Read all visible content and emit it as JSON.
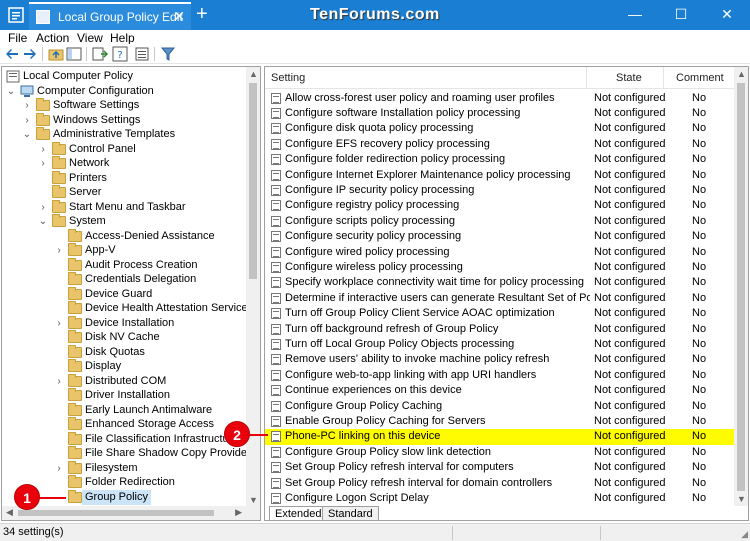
{
  "titlebar": {
    "tab_title": "Local Group Policy Edit",
    "tab_close": "✕",
    "new_tab": "+",
    "watermark": "TenForums.com",
    "minimize": "—",
    "maximize": "☐",
    "close": "✕"
  },
  "menu": {
    "items": [
      "File",
      "Action",
      "View",
      "Help"
    ]
  },
  "tree": {
    "items": [
      {
        "label": "Local Computer Policy"
      },
      {
        "label": "Computer Configuration"
      },
      {
        "label": "Software Settings"
      },
      {
        "label": "Windows Settings"
      },
      {
        "label": "Administrative Templates"
      },
      {
        "label": "Control Panel"
      },
      {
        "label": "Network"
      },
      {
        "label": "Printers"
      },
      {
        "label": "Server"
      },
      {
        "label": "Start Menu and Taskbar"
      },
      {
        "label": "System"
      },
      {
        "label": "Access-Denied Assistance"
      },
      {
        "label": "App-V"
      },
      {
        "label": "Audit Process Creation"
      },
      {
        "label": "Credentials Delegation"
      },
      {
        "label": "Device Guard"
      },
      {
        "label": "Device Health Attestation Service"
      },
      {
        "label": "Device Installation"
      },
      {
        "label": "Disk NV Cache"
      },
      {
        "label": "Disk Quotas"
      },
      {
        "label": "Display"
      },
      {
        "label": "Distributed COM"
      },
      {
        "label": "Driver Installation"
      },
      {
        "label": "Early Launch Antimalware"
      },
      {
        "label": "Enhanced Storage Access"
      },
      {
        "label": "File Classification Infrastructure"
      },
      {
        "label": "File Share Shadow Copy Provider"
      },
      {
        "label": "Filesystem"
      },
      {
        "label": "Folder Redirection"
      },
      {
        "label": "Group Policy"
      }
    ]
  },
  "list": {
    "headers": {
      "setting": "Setting",
      "state": "State",
      "comment": "Comment"
    },
    "rows": [
      {
        "name": "Allow cross-forest user policy and roaming user profiles",
        "state": "Not configured",
        "comment": "No"
      },
      {
        "name": "Configure software Installation policy processing",
        "state": "Not configured",
        "comment": "No"
      },
      {
        "name": "Configure disk quota policy processing",
        "state": "Not configured",
        "comment": "No"
      },
      {
        "name": "Configure EFS recovery policy processing",
        "state": "Not configured",
        "comment": "No"
      },
      {
        "name": "Configure folder redirection policy processing",
        "state": "Not configured",
        "comment": "No"
      },
      {
        "name": "Configure Internet Explorer Maintenance policy processing",
        "state": "Not configured",
        "comment": "No"
      },
      {
        "name": "Configure IP security policy processing",
        "state": "Not configured",
        "comment": "No"
      },
      {
        "name": "Configure registry policy processing",
        "state": "Not configured",
        "comment": "No"
      },
      {
        "name": "Configure scripts policy processing",
        "state": "Not configured",
        "comment": "No"
      },
      {
        "name": "Configure security policy processing",
        "state": "Not configured",
        "comment": "No"
      },
      {
        "name": "Configure wired policy processing",
        "state": "Not configured",
        "comment": "No"
      },
      {
        "name": "Configure wireless policy processing",
        "state": "Not configured",
        "comment": "No"
      },
      {
        "name": "Specify workplace connectivity wait time for policy processing",
        "state": "Not configured",
        "comment": "No"
      },
      {
        "name": "Determine if interactive users can generate Resultant Set of Policy data",
        "state": "Not configured",
        "comment": "No"
      },
      {
        "name": "Turn off Group Policy Client Service AOAC optimization",
        "state": "Not configured",
        "comment": "No"
      },
      {
        "name": "Turn off background refresh of Group Policy",
        "state": "Not configured",
        "comment": "No"
      },
      {
        "name": "Turn off Local Group Policy Objects processing",
        "state": "Not configured",
        "comment": "No"
      },
      {
        "name": "Remove users' ability to invoke machine policy refresh",
        "state": "Not configured",
        "comment": "No"
      },
      {
        "name": "Configure web-to-app linking with app URI handlers",
        "state": "Not configured",
        "comment": "No"
      },
      {
        "name": "Continue experiences on this device",
        "state": "Not configured",
        "comment": "No"
      },
      {
        "name": "Configure Group Policy Caching",
        "state": "Not configured",
        "comment": "No"
      },
      {
        "name": "Enable Group Policy Caching for Servers",
        "state": "Not configured",
        "comment": "No"
      },
      {
        "name": "Phone-PC linking on this device",
        "state": "Not configured",
        "comment": "No"
      },
      {
        "name": "Configure Group Policy slow link detection",
        "state": "Not configured",
        "comment": "No"
      },
      {
        "name": "Set Group Policy refresh interval for computers",
        "state": "Not configured",
        "comment": "No"
      },
      {
        "name": "Set Group Policy refresh interval for domain controllers",
        "state": "Not configured",
        "comment": "No"
      },
      {
        "name": "Configure Logon Script Delay",
        "state": "Not configured",
        "comment": "No"
      }
    ]
  },
  "tabs": {
    "extended": "Extended",
    "standard": "Standard"
  },
  "status": {
    "text": "34 setting(s)"
  },
  "callouts": {
    "one": "1",
    "two": "2"
  },
  "colors": {
    "titlebar": "#1a7fd2",
    "highlight": "#fffb00",
    "callout": "#e8000d",
    "selection": "#cce4f7"
  }
}
